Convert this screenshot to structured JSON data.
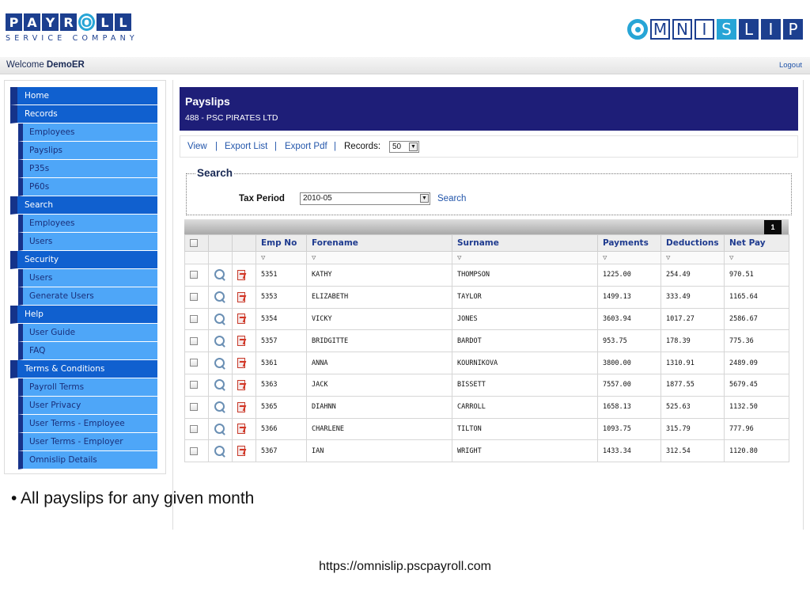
{
  "header": {
    "payroll_letters": [
      "P",
      "A",
      "Y",
      "R",
      "O",
      "L",
      "L"
    ],
    "payroll_tagline": "SERVICE COMPANY",
    "omnislip_letters": [
      "M",
      "N",
      "I",
      "S",
      "L",
      "I",
      "P"
    ]
  },
  "welcome": {
    "prefix": "Welcome",
    "user": "DemoER",
    "logout": "Logout"
  },
  "nav": {
    "items": [
      {
        "label": "Home",
        "type": "head"
      },
      {
        "label": "Records",
        "type": "head"
      },
      {
        "label": "Employees",
        "type": "sub"
      },
      {
        "label": "Payslips",
        "type": "sub"
      },
      {
        "label": "P35s",
        "type": "sub"
      },
      {
        "label": "P60s",
        "type": "sub"
      },
      {
        "label": "Search",
        "type": "head"
      },
      {
        "label": "Employees",
        "type": "sub"
      },
      {
        "label": "Users",
        "type": "sub"
      },
      {
        "label": "Security",
        "type": "head"
      },
      {
        "label": "Users",
        "type": "sub"
      },
      {
        "label": "Generate Users",
        "type": "sub"
      },
      {
        "label": "Help",
        "type": "head"
      },
      {
        "label": "User Guide",
        "type": "sub"
      },
      {
        "label": "FAQ",
        "type": "sub"
      },
      {
        "label": "Terms & Conditions",
        "type": "head"
      },
      {
        "label": "Payroll Terms",
        "type": "sub"
      },
      {
        "label": "User Privacy",
        "type": "sub"
      },
      {
        "label": "User Terms - Employee",
        "type": "sub"
      },
      {
        "label": "User Terms - Employer",
        "type": "sub"
      },
      {
        "label": "Omnislip Details",
        "type": "sub"
      }
    ]
  },
  "page": {
    "title": "Payslips",
    "company": "488 - PSC PIRATES LTD"
  },
  "toolbar": {
    "view": "View",
    "export_list": "Export List",
    "export_pdf": "Export Pdf",
    "separator": "|",
    "records_label": "Records:",
    "records_value": "50"
  },
  "search": {
    "legend": "Search",
    "tax_period_label": "Tax Period",
    "tax_period_value": "2010-05",
    "search_button": "Search"
  },
  "grid": {
    "page_number": "1",
    "columns": [
      "Emp No",
      "Forename",
      "Surname",
      "Payments",
      "Deductions",
      "Net Pay"
    ],
    "filter_symbol": "▽",
    "rows": [
      [
        "5351",
        "KATHY",
        "THOMPSON",
        "1225.00",
        "254.49",
        "970.51"
      ],
      [
        "5353",
        "ELIZABETH",
        "TAYLOR",
        "1499.13",
        "333.49",
        "1165.64"
      ],
      [
        "5354",
        "VICKY",
        "JONES",
        "3603.94",
        "1017.27",
        "2586.67"
      ],
      [
        "5357",
        "BRIDGITTE",
        "BARDOT",
        "953.75",
        "178.39",
        "775.36"
      ],
      [
        "5361",
        "ANNA",
        "KOURNIKOVA",
        "3800.00",
        "1310.91",
        "2489.09"
      ],
      [
        "5363",
        "JACK",
        "BISSETT",
        "7557.00",
        "1877.55",
        "5679.45"
      ],
      [
        "5365",
        "DIAHNN",
        "CARROLL",
        "1658.13",
        "525.63",
        "1132.50"
      ],
      [
        "5366",
        "CHARLENE",
        "TILTON",
        "1093.75",
        "315.79",
        "777.96"
      ],
      [
        "5367",
        "IAN",
        "WRIGHT",
        "1433.34",
        "312.54",
        "1120.80"
      ]
    ]
  },
  "caption": "• All payslips for any given month",
  "footer_url": "https://omnislip.pscpayroll.com",
  "colors": {
    "brand_navy": "#1e1e78",
    "nav_dark": "#1060cf",
    "nav_light": "#4ea6f8",
    "link": "#2255aa",
    "logo_cyan": "#27a5d6"
  }
}
